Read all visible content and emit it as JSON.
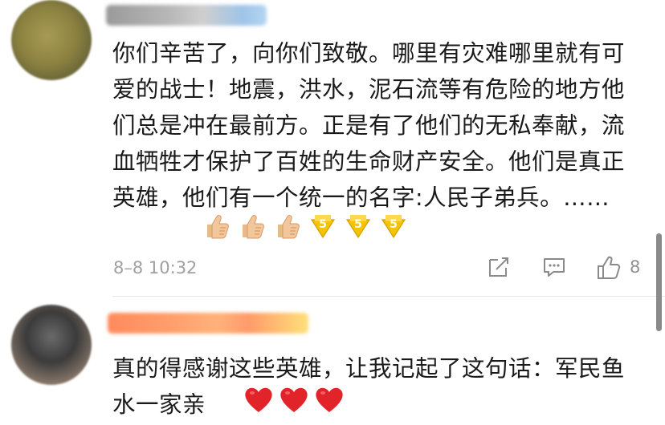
{
  "comments": [
    {
      "text": "你们辛苦了，向你们致敬。哪里有灾难哪里就有可爱的战士！地震，洪水，泥石流等有危险的地方他们总是冲在最前方。正是有了他们的无私奉献，流血牺牲才保护了百姓的生命财产安全。他们是真正英雄，他们有一个统一的名字:人民子弟兵。……",
      "emojis": [
        "thumbs-up-icon",
        "thumbs-up-icon",
        "thumbs-up-icon",
        "five-badge-icon",
        "five-badge-icon",
        "five-badge-icon"
      ],
      "timestamp": "8–8 10:32",
      "likes": "8"
    },
    {
      "text": "真的得感谢这些英雄，让我记起了这句话：军民鱼水一家亲",
      "emojis": [
        "heart-icon",
        "heart-icon",
        "heart-icon"
      ]
    }
  ],
  "colors": {
    "heart": "#e0242a",
    "thumb": "#f2c79c",
    "badge": "#f5c400",
    "meta_text": "#a0a0a0"
  }
}
